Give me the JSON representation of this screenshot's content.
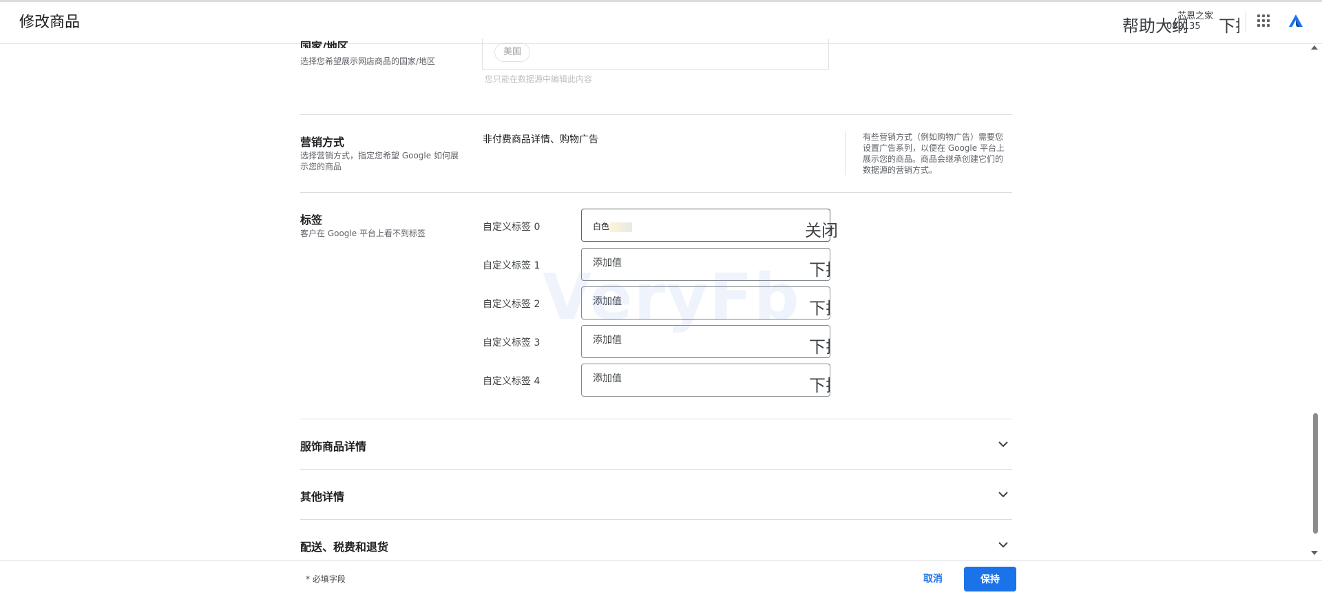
{
  "header": {
    "title": "修改商品",
    "help_outline": "帮助大纲",
    "account_name": "芯恩之家",
    "account_id": "082135",
    "account_dropdown": "下拉"
  },
  "country": {
    "label": "国家/地区",
    "description": "选择您希望展示网店商品的国家/地区",
    "chip": "美国",
    "hint": "您只能在数据源中编辑此内容"
  },
  "marketing": {
    "label": "营销方式",
    "description": "选择营销方式，指定您希望 Google 如何展示您的商品",
    "value": "非付费商品详情、购物广告",
    "side_note": "有些营销方式（例如购物广告）需要您设置广告系列，以便在 Google 平台上展示您的商品。商品会继承创建它们的数据源的营销方式。"
  },
  "labels": {
    "label": "标签",
    "description": "客户在 Google 平台上看不到标签",
    "close_text": "关闭",
    "fields": [
      {
        "name": "自定义标签 0",
        "value": "白色",
        "side": "下拉"
      },
      {
        "name": "自定义标签 1",
        "placeholder": "添加值",
        "side": "下拉"
      },
      {
        "name": "自定义标签 2",
        "placeholder": "添加值",
        "side": "下拉"
      },
      {
        "name": "自定义标签 3",
        "placeholder": "添加值",
        "side": "下拉"
      },
      {
        "name": "自定义标签 4",
        "placeholder": "添加值",
        "side": "下拉"
      }
    ]
  },
  "sections": [
    {
      "title": "服饰商品详情",
      "icon": "chevron-down-icon"
    },
    {
      "title": "其他详情",
      "icon": "chevron-down-icon"
    },
    {
      "title": "配送、税费和退货",
      "icon": "chevron-down-icon"
    }
  ],
  "watermark": "VeryFb",
  "footer": {
    "required_note": "* 必填字段",
    "cancel_label": "取消",
    "save_label": "保持"
  },
  "colors": {
    "accent": "#1a73e8",
    "text": "#202124",
    "secondary_text": "#5f6368",
    "divider": "#dadce0"
  }
}
